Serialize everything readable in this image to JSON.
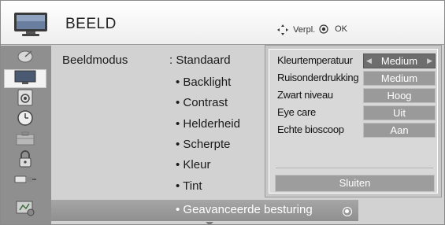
{
  "header": {
    "title": "BEELD",
    "hint_move": "Verpl.",
    "hint_ok": "OK",
    "icon": "tv-icon"
  },
  "sidebar": {
    "items": [
      {
        "icon": "satellite-dish-icon",
        "selected": false
      },
      {
        "icon": "tv-screen-icon",
        "selected": true
      },
      {
        "icon": "speaker-icon",
        "selected": false
      },
      {
        "icon": "clock-icon",
        "selected": false
      },
      {
        "icon": "lock-box-icon",
        "selected": false
      },
      {
        "icon": "padlock-icon",
        "selected": false
      },
      {
        "icon": "usb-plug-icon",
        "selected": false
      },
      {
        "icon": "support-icon",
        "selected": false
      }
    ]
  },
  "main": {
    "mode_label": "Beeldmodus",
    "mode_value": ": Standaard",
    "items": [
      "• Backlight",
      "• Contrast",
      "• Helderheid",
      "• Scherpte",
      "• Kleur",
      "• Tint",
      "• Geavanceerde besturing"
    ]
  },
  "popup": {
    "options": [
      {
        "label": "Kleurtemperatuur",
        "value": "Medium",
        "selected": true
      },
      {
        "label": "Ruisonderdrukking",
        "value": "Medium",
        "selected": false
      },
      {
        "label": "Zwart niveau",
        "value": "Hoog",
        "selected": false
      },
      {
        "label": "Eye care",
        "value": "Uit",
        "selected": false
      },
      {
        "label": "Echte bioscoop",
        "value": "Aan",
        "selected": false
      }
    ],
    "close_label": "Sluiten"
  },
  "colors": {
    "highlight": "#999999",
    "selected_value": "#6e6e6e",
    "value_box": "#9a9a9a"
  }
}
